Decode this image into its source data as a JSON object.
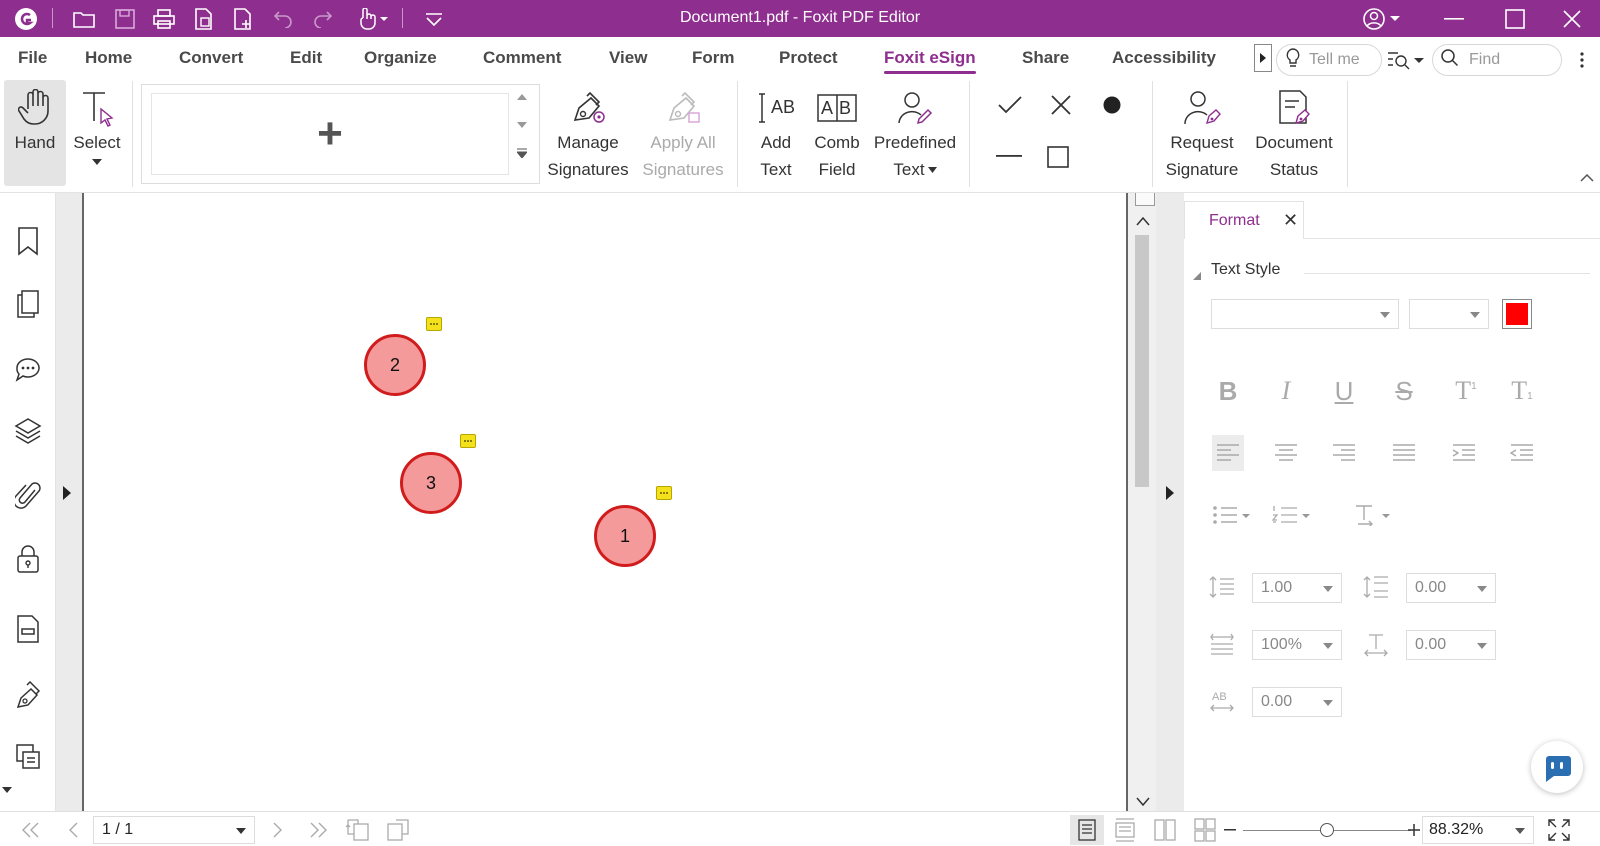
{
  "app": {
    "title": "Document1.pdf - Foxit PDF Editor",
    "accent": "#8e2e8e"
  },
  "menu": {
    "items": [
      "File",
      "Home",
      "Convert",
      "Edit",
      "Organize",
      "Comment",
      "View",
      "Form",
      "Protect",
      "Foxit eSign",
      "Share",
      "Accessibility"
    ],
    "active": "Foxit eSign",
    "tell_me_placeholder": "Tell me",
    "find_placeholder": "Find"
  },
  "ribbon": {
    "hand": "Hand",
    "select": "Select",
    "add_signature_symbol": "+",
    "manage_signatures": [
      "Manage",
      "Signatures"
    ],
    "apply_all_signatures": [
      "Apply All",
      "Signatures"
    ],
    "add_text": [
      "Add",
      "Text"
    ],
    "comb_field": [
      "Comb",
      "Field"
    ],
    "predefined_text": [
      "Predefined",
      "Text"
    ],
    "request_signature": [
      "Request",
      "Signature"
    ],
    "document_status": [
      "Document",
      "Status"
    ],
    "comb_icon_text": "AB",
    "add_text_icon_text": "AB"
  },
  "document": {
    "stamps": [
      {
        "label": "2"
      },
      {
        "label": "3"
      },
      {
        "label": "1"
      }
    ],
    "stamp_fill": "#f59a9a",
    "stamp_border": "#d01c1c",
    "note_color": "#f3e21b"
  },
  "format_panel": {
    "tab_label": "Format",
    "close_symbol": "✕",
    "section_title": "Text Style",
    "font_name": "",
    "font_size": "",
    "text_color": "#ff0000",
    "style_buttons": [
      "B",
      "I",
      "U",
      "S",
      "T",
      "T"
    ],
    "line_spacing": "1.00",
    "paragraph_spacing": "0.00",
    "horizontal_scale": "100%",
    "baseline_offset": "0.00",
    "char_spacing": "0.00"
  },
  "status": {
    "page": "1 / 1",
    "zoom": "88.32%",
    "zoom_level_fraction": 0.5
  }
}
